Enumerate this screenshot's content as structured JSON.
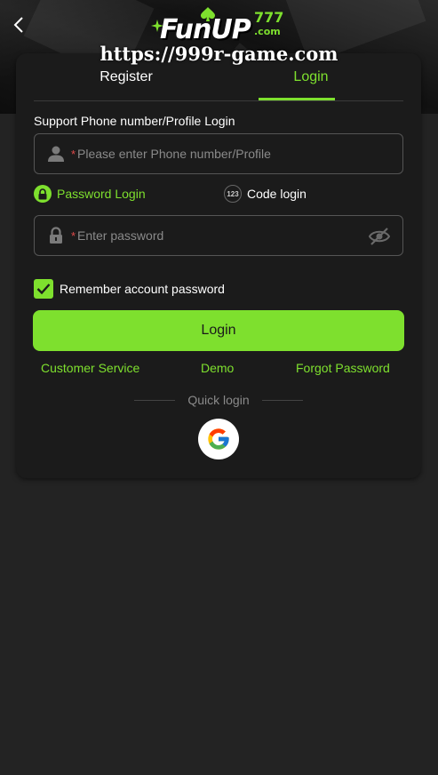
{
  "header": {
    "logo_text": "FunUP",
    "logo_number": "777",
    "logo_suffix": ".com",
    "site_url": "https://999r-game.com"
  },
  "tabs": [
    {
      "label": "Register",
      "active": false
    },
    {
      "label": "Login",
      "active": true
    }
  ],
  "form": {
    "account_label": "Support Phone number/Profile Login",
    "required_mark": "*",
    "account_placeholder": "Please enter Phone number/Profile",
    "account_value": "",
    "password_placeholder": "Enter password",
    "password_value": "",
    "login_modes": [
      {
        "label": "Password Login",
        "icon": "lock-icon",
        "active": true
      },
      {
        "label": "Code login",
        "icon": "code-123-icon",
        "badge": "123",
        "active": false
      }
    ],
    "remember_label": "Remember account password",
    "remember_checked": true,
    "submit_label": "Login"
  },
  "links": {
    "customer_service": "Customer Service",
    "demo": "Demo",
    "forgot_password": "Forgot Password"
  },
  "quick_login": {
    "label": "Quick login",
    "providers": [
      "google-icon"
    ]
  },
  "colors": {
    "accent": "#7ee02e",
    "background": "#232323",
    "card": "#1b1b1b",
    "required": "#e04a4a"
  }
}
